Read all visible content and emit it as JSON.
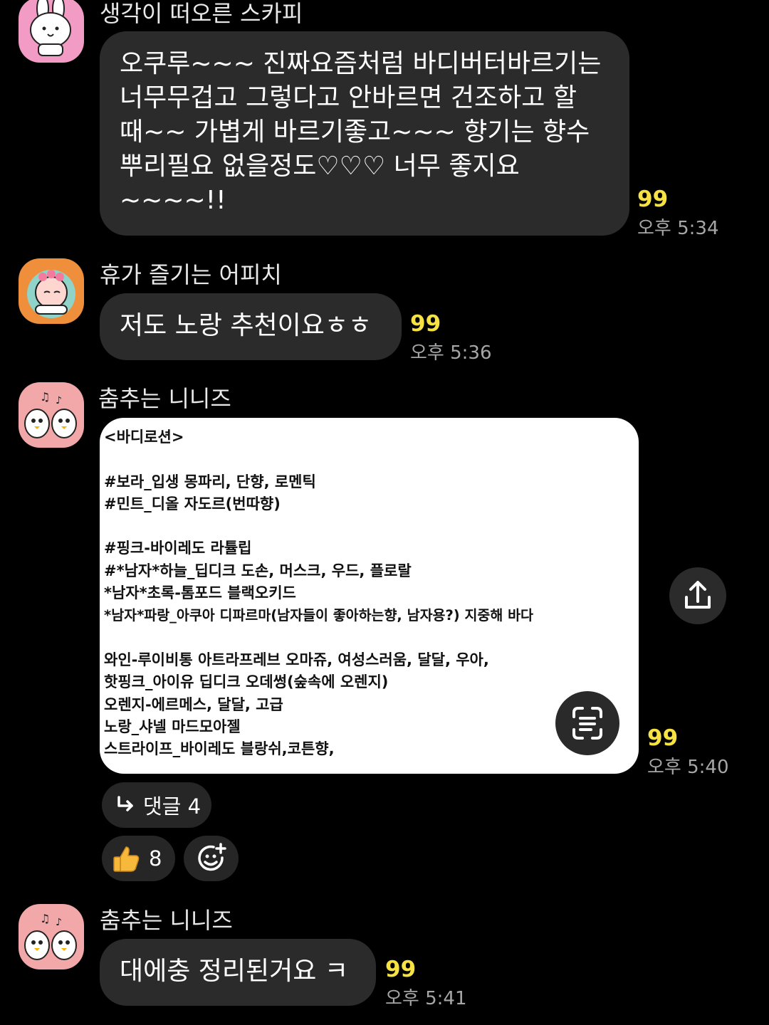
{
  "messages": [
    {
      "sender": "생각이 떠오른 스카피",
      "text": "오쿠루~~~ 진짜요즘처럼 바디버터바르기는\n너무무겁고 그렇다고 안바르면 건조하고 할\n때~~ 가볍게 바르기좋고~~~ 향기는 향수\n뿌리필요 없을정도♡♡♡ 너무 좋지요\n~~~~!!",
      "unread": "99",
      "time": "오후 5:34"
    },
    {
      "sender": "휴가 즐기는 어피치",
      "text": "저도 노랑 추천이요ㅎㅎ",
      "unread": "99",
      "time": "오후 5:36"
    },
    {
      "sender": "춤추는 니니즈",
      "note_lines": [
        "<바디로션>",
        "",
        "#보라_입생 몽파리, 단향, 로멘틱",
        "#민트_디올 자도르(번따향)",
        "",
        "#핑크-바이레도 라튤립",
        "#*남자*하늘_딥디크 도손, 머스크, 우드, 플로랄",
        "*남자*초록-톰포드 블랙오키드",
        "*남자*파랑_아쿠아 디파르마(남자들이 좋아하는향, 남자용?) 지중해 바다",
        "",
        "와인-루이비통 아트라프레브 오마쥬, 여성스러움, 달달, 우아,",
        "핫핑크_아이유 딥디크 오데썽(숲속에 오렌지)",
        "오렌지-에르메스, 달달, 고급",
        "노랑_샤넬 마드모아젤",
        "스트라이프_바이레도 블랑쉬,코튼향,"
      ],
      "unread": "99",
      "time": "오후 5:40",
      "reply_label": "댓글 4",
      "reaction_count": "8"
    },
    {
      "sender": "춤추는 니니즈",
      "text": "대에충 정리된거요 ㅋ",
      "unread": "99",
      "time": "오후 5:41"
    }
  ],
  "icons": {
    "share": "share-icon",
    "text_scan": "text-scan-icon",
    "reply_arrow": "reply-arrow-icon",
    "thumbs_up": "thumbs-up-icon",
    "add_reaction": "add-reaction-icon"
  },
  "colors": {
    "background": "#000000",
    "bubble": "#2b2b2b",
    "unread": "#f7e244",
    "time": "#a6a6a6"
  }
}
